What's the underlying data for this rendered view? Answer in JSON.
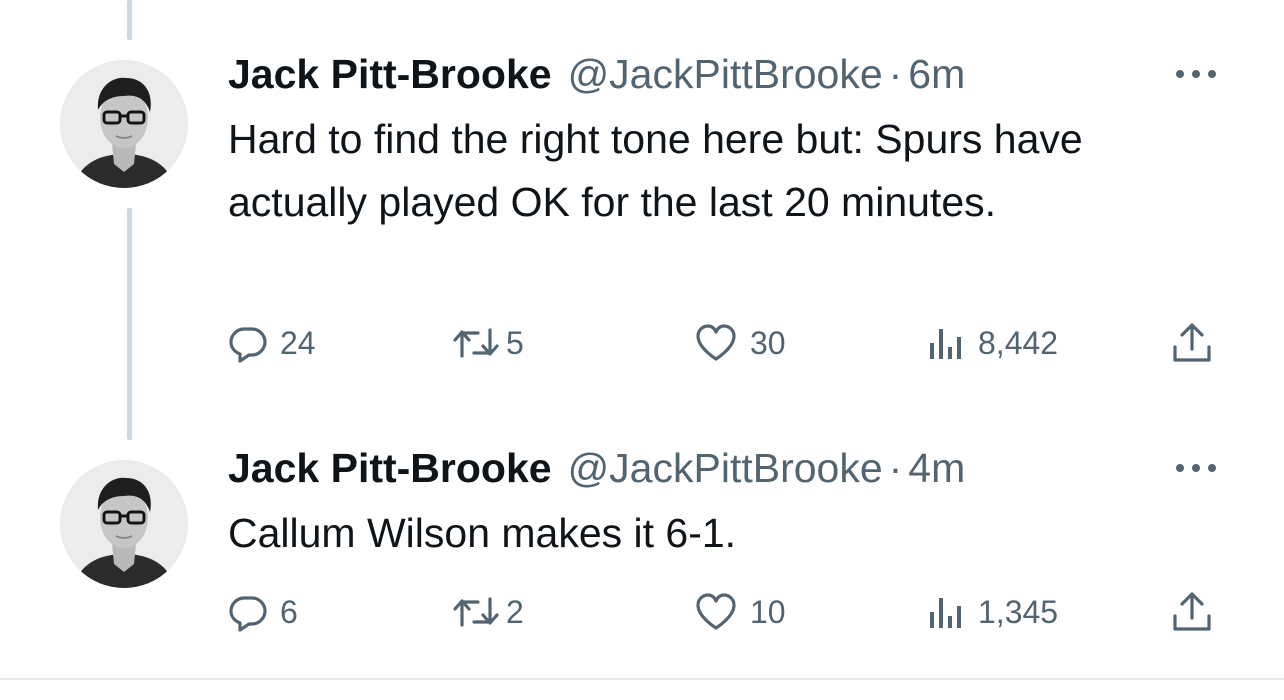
{
  "tweets": [
    {
      "author_name": "Jack Pitt-Brooke",
      "handle": "@JackPittBrooke",
      "separator": "·",
      "time": "6m",
      "text": "Hard to find the right tone here but: Spurs have actually played OK for the last 20 minutes.",
      "replies": "24",
      "retweets": "5",
      "likes": "30",
      "views": "8,442"
    },
    {
      "author_name": "Jack Pitt-Brooke",
      "handle": "@JackPittBrooke",
      "separator": "·",
      "time": "4m",
      "text": "Callum Wilson makes it 6-1.",
      "replies": "6",
      "retweets": "2",
      "likes": "10",
      "views": "1,345"
    }
  ],
  "icons": {
    "reply": "reply-icon",
    "retweet": "retweet-icon",
    "like": "heart-icon",
    "views": "views-icon",
    "share": "share-icon",
    "more": "more-icon"
  },
  "colors": {
    "text_primary": "#0f1419",
    "text_secondary": "#536471",
    "thread_line": "#cfd9de"
  }
}
